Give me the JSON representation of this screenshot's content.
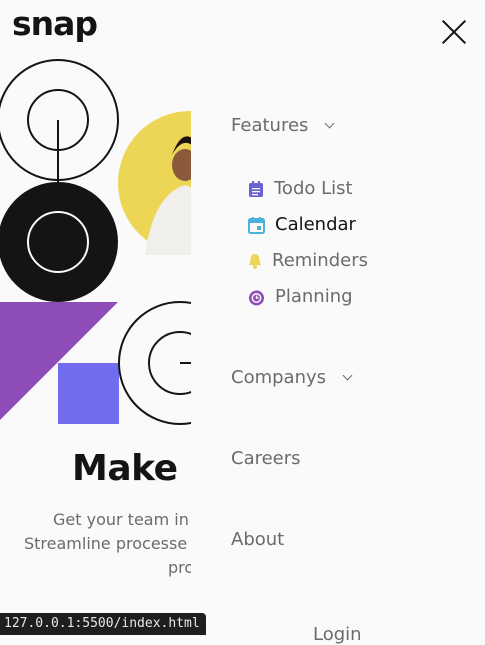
{
  "header": {
    "logo": "snap"
  },
  "hero": {
    "headline_visible": "Make r",
    "sub_line1": "Get your team in s",
    "sub_line2": "Streamline processe",
    "sub_line3": "pro"
  },
  "menu": {
    "features": "Features",
    "features_items": [
      {
        "label": "Todo List",
        "icon": "todo-icon",
        "color": "#6c62d1"
      },
      {
        "label": "Calendar",
        "icon": "calendar-icon",
        "color": "#4bb1da"
      },
      {
        "label": "Reminders",
        "icon": "bell-icon",
        "color": "#edd556"
      },
      {
        "label": "Planning",
        "icon": "planning-icon",
        "color": "#8e4cb6"
      }
    ],
    "companys": "Companys",
    "careers": "Careers",
    "about": "About",
    "login": "Login"
  },
  "statusbar": {
    "url": "127.0.0.1:5500/index.html"
  },
  "colors": {
    "accent_purple": "#8e4cb6",
    "square_blue": "#726cee",
    "circle_yellow": "#edd556",
    "text": "#141414",
    "muted": "#6b6b6b"
  }
}
